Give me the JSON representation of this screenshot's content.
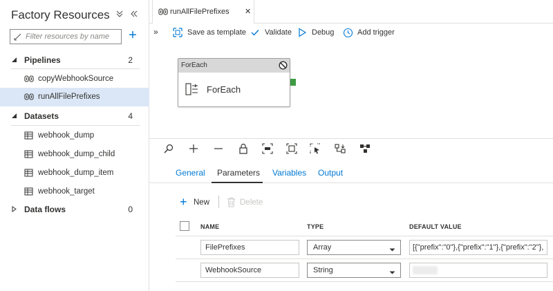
{
  "sidebar": {
    "title": "Factory Resources",
    "search_placeholder": "Filter resources by name",
    "groups": [
      {
        "label": "Pipelines",
        "count": "2",
        "expanded": true,
        "items": [
          {
            "label": "copyWebhookSource"
          },
          {
            "label": "runAllFilePrefixes",
            "selected": true
          }
        ]
      },
      {
        "label": "Datasets",
        "count": "4",
        "expanded": true,
        "items": [
          {
            "label": "webhook_dump"
          },
          {
            "label": "webhook_dump_child"
          },
          {
            "label": "webhook_dump_item"
          },
          {
            "label": "webhook_target"
          }
        ]
      },
      {
        "label": "Data flows",
        "count": "0",
        "expanded": false,
        "items": []
      }
    ]
  },
  "tab": {
    "label": "runAllFilePrefixes",
    "close_glyph": "✕"
  },
  "toolbar": {
    "save_template_label": "Save as template",
    "validate_label": "Validate",
    "debug_label": "Debug",
    "add_trigger_label": "Add trigger"
  },
  "activity": {
    "type": "ForEach",
    "name": "ForEach"
  },
  "panel_tabs": [
    {
      "label": "General"
    },
    {
      "label": "Parameters",
      "active": true
    },
    {
      "label": "Variables"
    },
    {
      "label": "Output"
    }
  ],
  "actions": {
    "new_label": "New",
    "delete_label": "Delete"
  },
  "params_table": {
    "headers": {
      "name": "NAME",
      "type": "TYPE",
      "default": "DEFAULT VALUE"
    },
    "rows": [
      {
        "name": "FilePrefixes",
        "type": "Array",
        "default": "[{\"prefix\":\"0\"},{\"prefix\":\"1\"},{\"prefix\":\"2\"},"
      },
      {
        "name": "WebhookSource",
        "type": "String",
        "default": ""
      }
    ]
  },
  "colors": {
    "accent": "#0078d4",
    "selected_bg": "#dbe7f6",
    "handle_green": "#3e9b44"
  }
}
